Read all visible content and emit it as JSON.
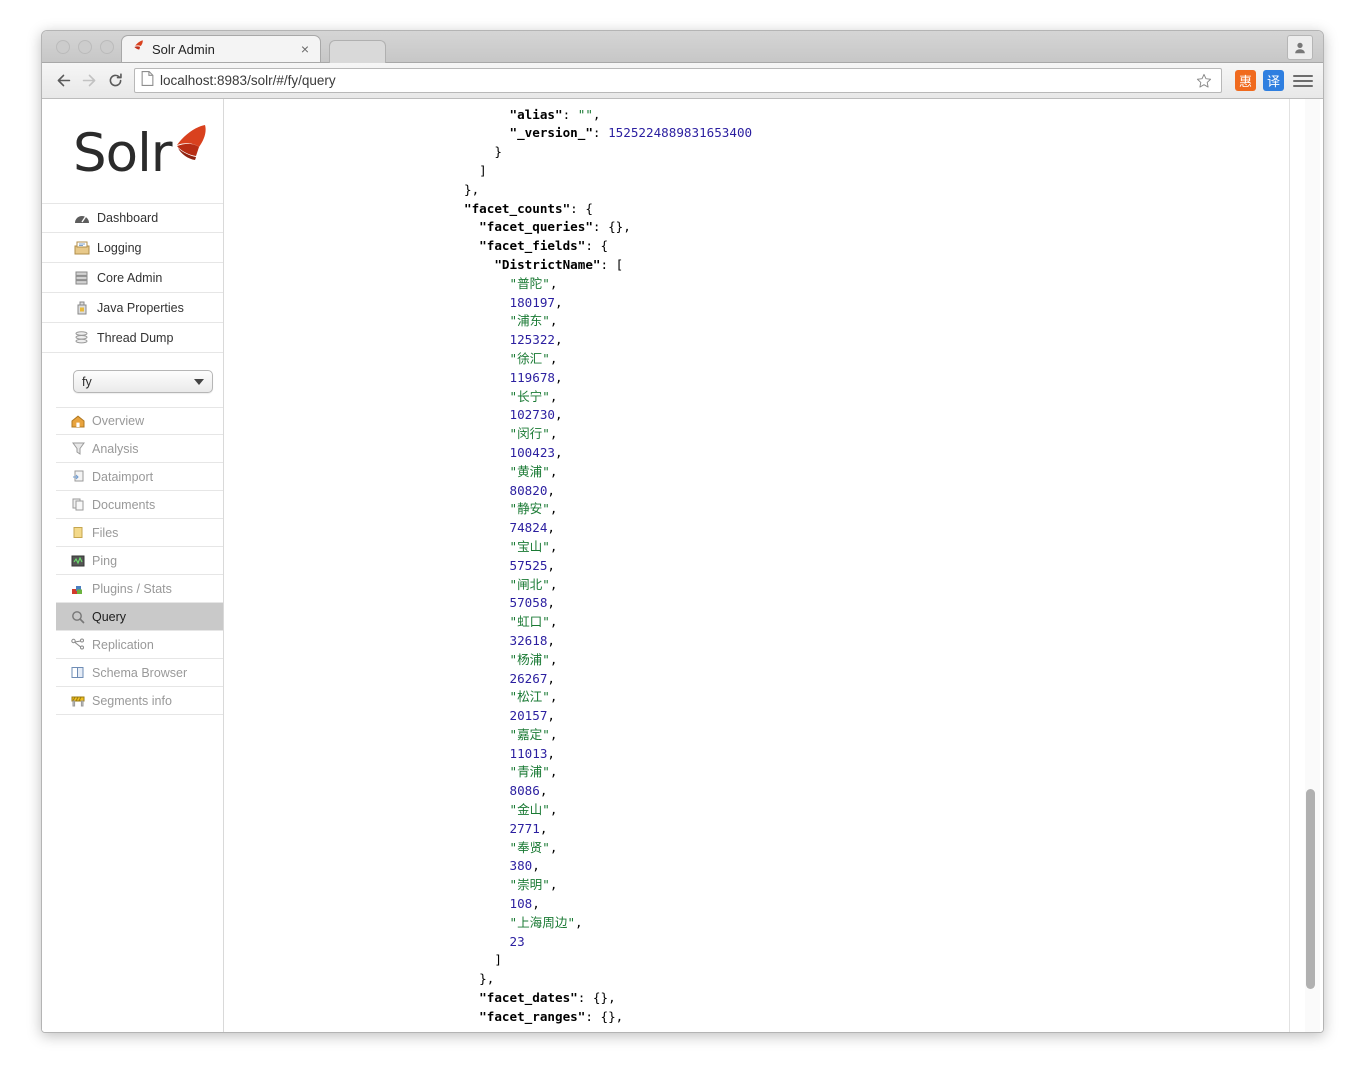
{
  "browser": {
    "tab": {
      "title": "Solr Admin",
      "close_label": "×",
      "favicon": "solr-favicon"
    },
    "toolbar": {
      "back_label": "←",
      "forward_label": "→",
      "reload_label": "↻",
      "url_scheme": "localhost:8983",
      "url_path": "/solr/#/fy/query",
      "url_full": "localhost:8983/solr/#/fy/query",
      "star_label": "☆",
      "extensions": [
        {
          "name": "hui-extension",
          "label": "惠",
          "color": "#f06a1e"
        },
        {
          "name": "translate-extension",
          "label": "译",
          "color": "#2f7fe0"
        }
      ],
      "menu_label": "☰"
    },
    "profile_label": "profile"
  },
  "translate_badge": {
    "label": "译",
    "color": "#3d7fe8"
  },
  "solr": {
    "logo_text": "Solr",
    "top_nav": [
      {
        "label": "Dashboard",
        "icon": "dashboard-icon"
      },
      {
        "label": "Logging",
        "icon": "logging-icon"
      },
      {
        "label": "Core Admin",
        "icon": "core-admin-icon"
      },
      {
        "label": "Java Properties",
        "icon": "java-properties-icon"
      },
      {
        "label": "Thread Dump",
        "icon": "thread-dump-icon"
      }
    ],
    "core_selector": {
      "value": "fy",
      "caret": "chevron-down-icon"
    },
    "core_nav": [
      {
        "label": "Overview",
        "icon": "home-icon",
        "active": false
      },
      {
        "label": "Analysis",
        "icon": "funnel-icon",
        "active": false
      },
      {
        "label": "Dataimport",
        "icon": "dataimport-icon",
        "active": false
      },
      {
        "label": "Documents",
        "icon": "documents-icon",
        "active": false
      },
      {
        "label": "Files",
        "icon": "folder-icon",
        "active": false
      },
      {
        "label": "Ping",
        "icon": "ping-icon",
        "active": false
      },
      {
        "label": "Plugins / Stats",
        "icon": "plugins-icon",
        "active": false
      },
      {
        "label": "Query",
        "icon": "magnifier-icon",
        "active": true
      },
      {
        "label": "Replication",
        "icon": "replication-icon",
        "active": false
      },
      {
        "label": "Schema Browser",
        "icon": "schema-browser-icon",
        "active": false
      },
      {
        "label": "Segments info",
        "icon": "segments-icon",
        "active": false
      }
    ]
  },
  "response": {
    "alias_key": "alias",
    "alias_value": "",
    "version_key": "_version_",
    "version_value": "1525224889831653400",
    "facet_counts_key": "facet_counts",
    "facet_queries_key": "facet_queries",
    "facet_queries_value": "{}",
    "facet_fields_key": "facet_fields",
    "district_field_key": "DistrictName",
    "facet_dates_key": "facet_dates",
    "facet_dates_value": "{}",
    "facet_ranges_key": "facet_ranges",
    "facet_ranges_value": "{}",
    "facets": [
      {
        "name": "普陀",
        "count": 180197
      },
      {
        "name": "浦东",
        "count": 125322
      },
      {
        "name": "徐汇",
        "count": 119678
      },
      {
        "name": "长宁",
        "count": 102730
      },
      {
        "name": "闵行",
        "count": 100423
      },
      {
        "name": "黄浦",
        "count": 80820
      },
      {
        "name": "静安",
        "count": 74824
      },
      {
        "name": "宝山",
        "count": 57525
      },
      {
        "name": "闸北",
        "count": 57058
      },
      {
        "name": "虹口",
        "count": 32618
      },
      {
        "name": "杨浦",
        "count": 26267
      },
      {
        "name": "松江",
        "count": 20157
      },
      {
        "name": "嘉定",
        "count": 11013
      },
      {
        "name": "青浦",
        "count": 8086
      },
      {
        "name": "金山",
        "count": 2771
      },
      {
        "name": "奉贤",
        "count": 380
      },
      {
        "name": "崇明",
        "count": 108
      },
      {
        "name": "上海周边",
        "count": 23
      }
    ]
  }
}
